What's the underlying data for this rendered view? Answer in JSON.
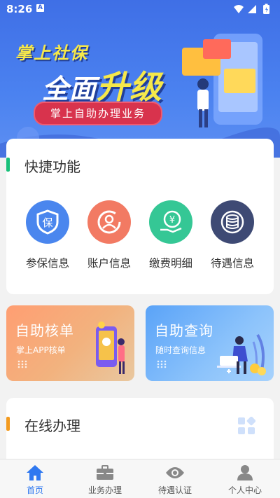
{
  "status_bar": {
    "time": "8:26",
    "notification_glyph": "A"
  },
  "banner": {
    "headline": "掌上社保",
    "slogan_part1": "全面",
    "slogan_part2": "升级",
    "pill_text": "掌上自助办理业务"
  },
  "quick": {
    "title": "快捷功能",
    "accent_color": "#19c07a",
    "items": [
      {
        "label": "参保信息",
        "icon": "shield-bao-icon",
        "color": "#4a86ee"
      },
      {
        "label": "账户信息",
        "icon": "user-refresh-icon",
        "color": "#f27a63"
      },
      {
        "label": "缴费明细",
        "icon": "yen-hand-icon",
        "color": "#35c795"
      },
      {
        "label": "待遇信息",
        "icon": "coin-stack-icon",
        "color": "#3e4a74"
      }
    ]
  },
  "promos": [
    {
      "title": "自助核单",
      "subtitle": "掌上APP核单",
      "icon": "phone-person-illustration"
    },
    {
      "title": "自助查询",
      "subtitle": "随时查询信息",
      "icon": "laptop-person-illustration"
    }
  ],
  "online": {
    "title": "在线办理",
    "accent_color": "#f39a1e"
  },
  "tabbar": {
    "active_color": "#2f78f0",
    "items": [
      {
        "label": "首页",
        "icon": "home-icon"
      },
      {
        "label": "业务办理",
        "icon": "briefcase-icon"
      },
      {
        "label": "待遇认证",
        "icon": "eye-icon"
      },
      {
        "label": "个人中心",
        "icon": "person-icon"
      }
    ]
  }
}
